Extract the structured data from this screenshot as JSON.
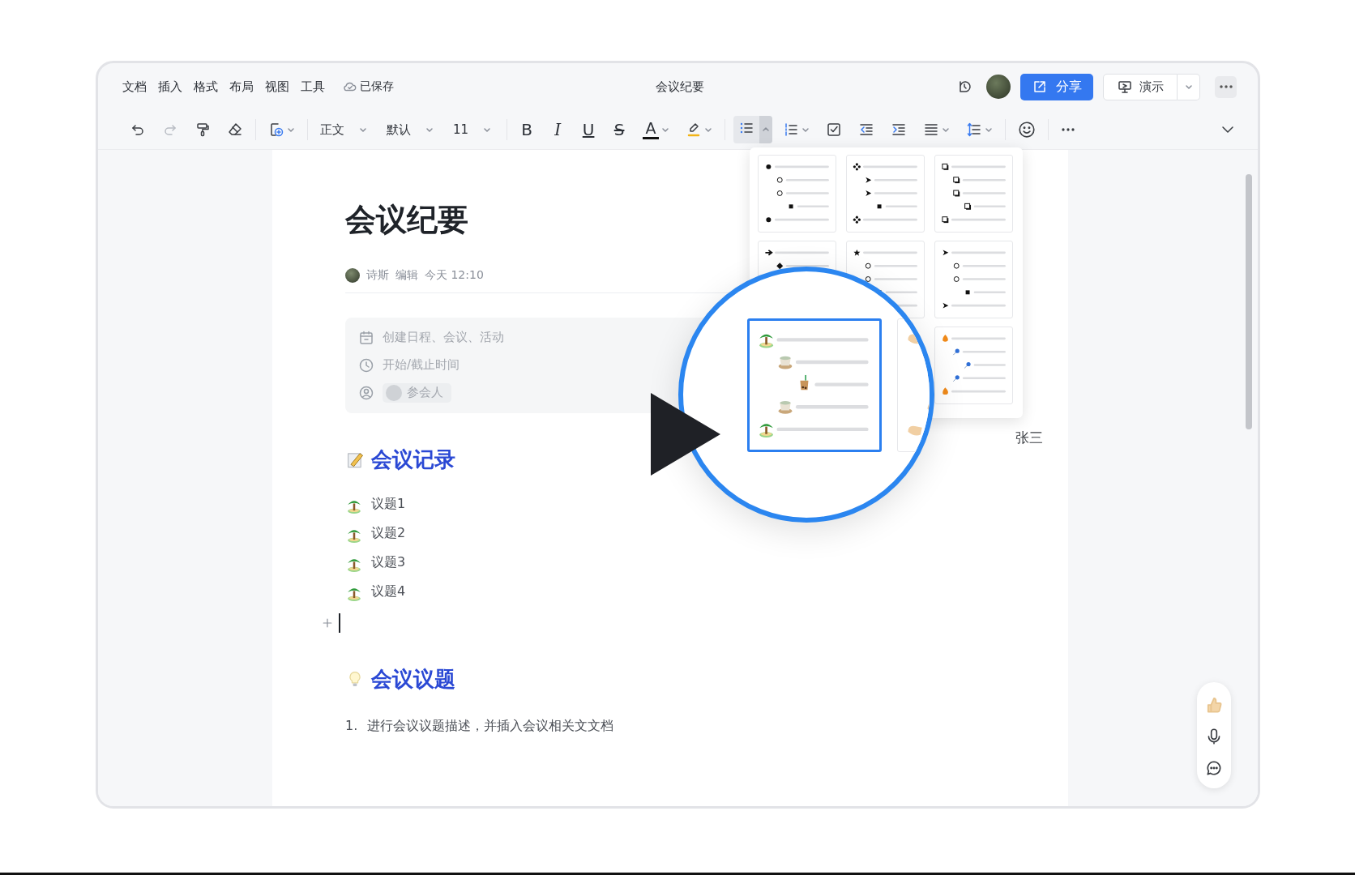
{
  "menu": [
    "文档",
    "插入",
    "格式",
    "布局",
    "视图",
    "工具"
  ],
  "save_status": "已保存",
  "title": "会议纪要",
  "share_button": "分享",
  "present_button": "演示",
  "toolbar": {
    "style": "正文",
    "font": "默认",
    "size": "11",
    "bold": "B",
    "italic": "I",
    "underline": "U",
    "strike": "S",
    "text_color_label": "A",
    "bullet_list": {
      "selected": true,
      "expanded": true
    }
  },
  "doc": {
    "title": "会议纪要",
    "author": "诗斯",
    "action": "编辑",
    "time": "今天 12:10",
    "schedule": {
      "event": "创建日程、会议、活动",
      "time": "开始/截止时间",
      "attendees": "参会人"
    },
    "sections": [
      {
        "kind": "notes",
        "heading": "会议记录",
        "items": [
          "议题1",
          "议题2",
          "议题3",
          "议题4"
        ]
      },
      {
        "kind": "topics",
        "heading": "会议议题",
        "numbered": [
          {
            "number": "1.",
            "text": "进行会议议题描述，并插入会议相关文文档"
          }
        ]
      }
    ]
  },
  "collaborator_label": "张三",
  "bullet_styles": [
    {
      "kind": "dots",
      "selected": false
    },
    {
      "kind": "diamonds",
      "selected": false
    },
    {
      "kind": "squares",
      "selected": false
    },
    {
      "kind": "arrows",
      "selected": false
    },
    {
      "kind": "stars",
      "selected": false
    },
    {
      "kind": "chevrons",
      "selected": false
    },
    {
      "kind": "palms",
      "selected": true
    },
    {
      "kind": "hands",
      "selected": false
    },
    {
      "kind": "fires",
      "selected": false
    }
  ]
}
